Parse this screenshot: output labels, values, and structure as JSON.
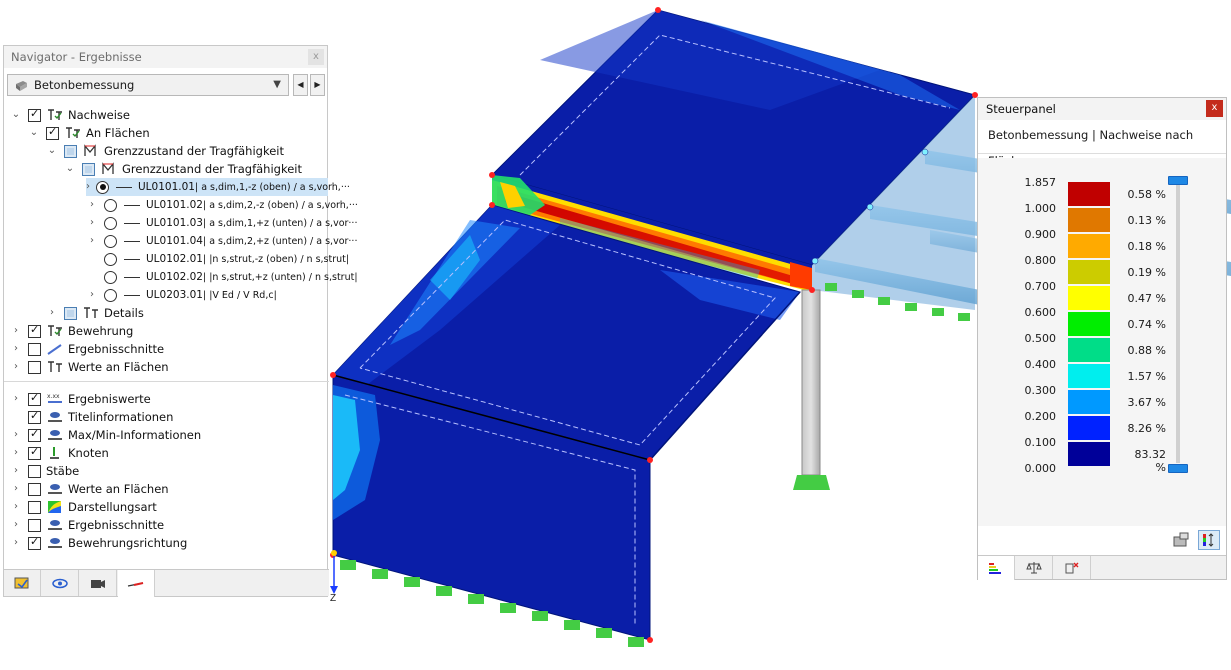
{
  "navigator": {
    "title": "Navigator - Ergebnisse",
    "close_label": "x",
    "combo": {
      "selected": "Betonbemessung"
    },
    "tree": {
      "nachweise": "Nachweise",
      "an_flaechen": "An Flächen",
      "grenzzustand_1": "Grenzzustand der Tragfähigkeit",
      "grenzzustand_2": "Grenzzustand der Tragfähigkeit",
      "checks": [
        {
          "code": "UL0101.01",
          "formula": " | a s,dim,1,-z (oben) / a s,vorh,···"
        },
        {
          "code": "UL0101.02",
          "formula": " | a s,dim,2,-z (oben) / a s,vorh,···"
        },
        {
          "code": "UL0101.03",
          "formula": " | a s,dim,1,+z (unten) / a s,vor···"
        },
        {
          "code": "UL0101.04",
          "formula": " | a s,dim,2,+z (unten) / a s,vor···"
        },
        {
          "code": "UL0102.01",
          "formula": " | |n s,strut,-z (oben) / n s,strut|"
        },
        {
          "code": "UL0102.02",
          "formula": " | |n s,strut,+z (unten) / n s,strut|"
        },
        {
          "code": "UL0203.01",
          "formula": " | |V Ed / V Rd,c|"
        }
      ],
      "details": "Details",
      "bewehrung": "Bewehrung",
      "ergebnisschnitte": "Ergebnisschnitte",
      "werte_an_flaechen": "Werte an Flächen",
      "display": [
        {
          "label": "Ergebniswerte",
          "checked": true,
          "icon": "result-values-icon"
        },
        {
          "label": "Titelinformationen",
          "checked": true,
          "icon": "title-info-icon"
        },
        {
          "label": "Max/Min-Informationen",
          "checked": true,
          "icon": "maxmin-info-icon"
        },
        {
          "label": "Knoten",
          "checked": true,
          "icon": "node-icon"
        },
        {
          "label": "Stäbe",
          "checked": false,
          "icon": "member-icon"
        },
        {
          "label": "Werte an Flächen",
          "checked": false,
          "icon": "surface-values-icon"
        },
        {
          "label": "Darstellungsart",
          "checked": false,
          "icon": "display-type-icon"
        },
        {
          "label": "Ergebnisschnitte",
          "checked": false,
          "icon": "result-section-icon"
        },
        {
          "label": "Bewehrungsrichtung",
          "checked": true,
          "icon": "reinforcement-direction-icon"
        }
      ]
    }
  },
  "steuerpanel": {
    "title": "Steuerpanel",
    "close_label": "x",
    "subtitle": "Betonbemessung | Nachweise nach Flächen",
    "legend": [
      {
        "value": "1.857",
        "color": "#c00000",
        "percent": "0.58 %"
      },
      {
        "value": "1.000",
        "color": "#e07800",
        "percent": "0.13 %"
      },
      {
        "value": "0.900",
        "color": "#ffaa00",
        "percent": "0.18 %"
      },
      {
        "value": "0.800",
        "color": "#cccc00",
        "percent": "0.19 %"
      },
      {
        "value": "0.700",
        "color": "#ffff00",
        "percent": "0.47 %"
      },
      {
        "value": "0.600",
        "color": "#00ee00",
        "percent": "0.74 %"
      },
      {
        "value": "0.500",
        "color": "#00dd88",
        "percent": "0.88 %"
      },
      {
        "value": "0.400",
        "color": "#00eeee",
        "percent": "1.57 %"
      },
      {
        "value": "0.300",
        "color": "#0099ff",
        "percent": "3.67 %"
      },
      {
        "value": "0.200",
        "color": "#0022ff",
        "percent": "8.26 %"
      },
      {
        "value": "0.100",
        "color": "#000099",
        "percent": "83.32 %"
      }
    ],
    "legend_last": "0.000"
  },
  "viewport": {
    "axis_label": "Z"
  },
  "colors": {
    "structure": "#0a1ea8",
    "hot": "#d80000",
    "support": "#44cc44"
  }
}
